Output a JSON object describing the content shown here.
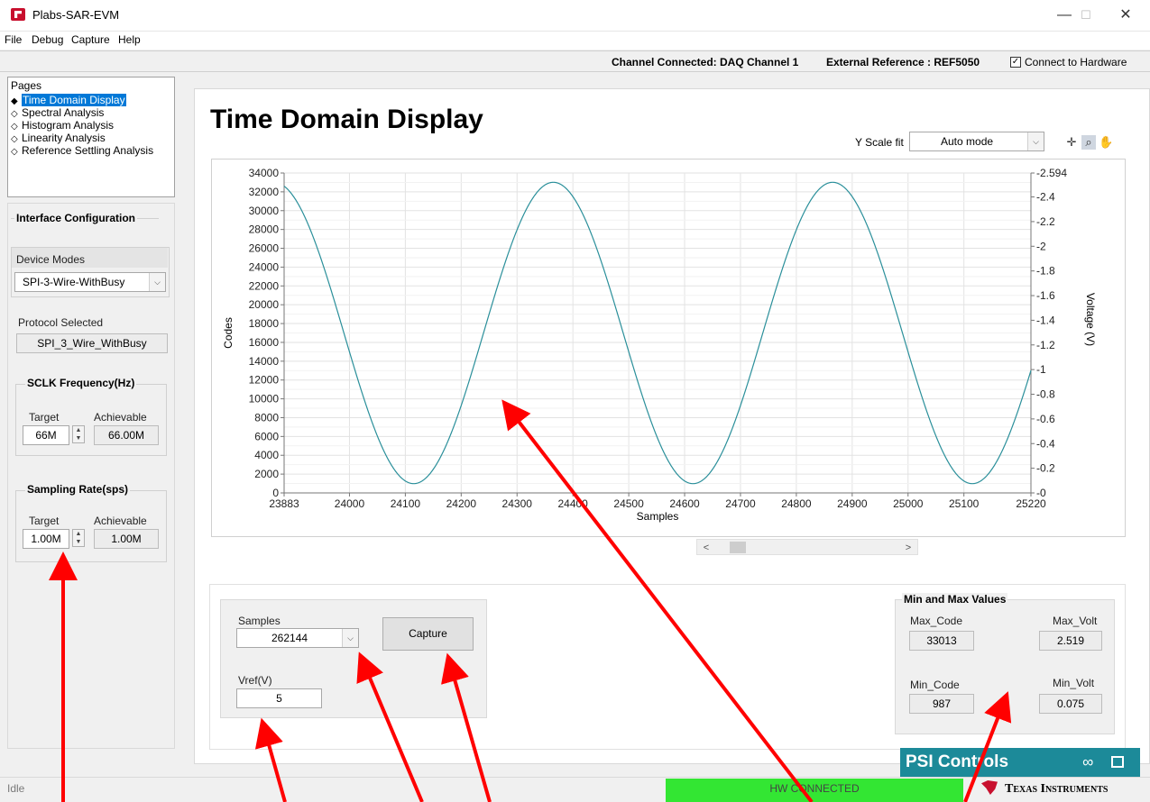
{
  "window": {
    "title": "Plabs-SAR-EVM",
    "minimize": "—",
    "maximize": "☐",
    "close": "✕"
  },
  "menu": [
    "File",
    "Debug",
    "Capture",
    "Help"
  ],
  "status_strip": {
    "channel": "Channel Connected: DAQ Channel 1",
    "reference": "External Reference : REF5050",
    "connect_label": "Connect to Hardware",
    "connect_checked": "✓"
  },
  "pages": {
    "title": "Pages",
    "items": [
      {
        "label": "Time Domain Display",
        "glyph": "◆"
      },
      {
        "label": "Spectral Analysis",
        "glyph": "◇"
      },
      {
        "label": "Histogram Analysis",
        "glyph": "◇"
      },
      {
        "label": "Linearity Analysis",
        "glyph": "◇"
      },
      {
        "label": "Reference Settling Analysis",
        "glyph": "◇"
      }
    ]
  },
  "interface": {
    "title": "Interface Configuration",
    "device_modes_label": "Device Modes",
    "device_mode_value": "SPI-3-Wire-WithBusy",
    "protocol_label": "Protocol Selected",
    "protocol_value": "SPI_3_Wire_WithBusy",
    "sclk": {
      "title": "SCLK Frequency(Hz)",
      "target_label": "Target",
      "achievable_label": "Achievable",
      "target_value": "66M",
      "achievable_value": "66.00M"
    },
    "sampling": {
      "title": "Sampling Rate(sps)",
      "target_label": "Target",
      "achievable_label": "Achievable",
      "target_value": "1.00M",
      "achievable_value": "1.00M"
    }
  },
  "main": {
    "title": "Time Domain Display",
    "yscale_label": "Y Scale fit",
    "yscale_value": "Auto mode",
    "tools": [
      "crosshair-icon",
      "zoom-icon",
      "pan-hand-icon"
    ]
  },
  "chart_data": {
    "type": "line",
    "xlabel": "Samples",
    "ylabel": "Codes",
    "y2label": "Voltage (V)",
    "xlim": [
      23883,
      25220
    ],
    "ylim": [
      0,
      34000
    ],
    "y2lim": [
      0,
      2.594
    ],
    "xticks": [
      "23883",
      "24000",
      "24100",
      "24200",
      "24300",
      "24400",
      "24500",
      "24600",
      "24700",
      "24800",
      "24900",
      "25000",
      "25100",
      "25220"
    ],
    "yticks": [
      "0",
      "2000",
      "4000",
      "6000",
      "8000",
      "10000",
      "12000",
      "14000",
      "16000",
      "18000",
      "20000",
      "22000",
      "24000",
      "26000",
      "28000",
      "30000",
      "32000",
      "34000"
    ],
    "y2ticks": [
      "0",
      "0.2",
      "0.4",
      "0.6",
      "0.8",
      "1",
      "1.2",
      "1.4",
      "1.6",
      "1.8",
      "2",
      "2.2",
      "2.4",
      "2.594"
    ],
    "grid": true,
    "series": [
      {
        "color": "#2a8f9a",
        "waveform": "sine",
        "min": 987,
        "max": 33013,
        "period_samples": 500,
        "first_min_at": 24115
      }
    ]
  },
  "capture": {
    "samples_label": "Samples",
    "samples_value": "262144",
    "capture_button": "Capture",
    "vref_label": "Vref(V)",
    "vref_value": "5"
  },
  "minmax": {
    "title": "Min and Max Values",
    "max_code_label": "Max_Code",
    "max_code_value": "33013",
    "max_volt_label": "Max_Volt",
    "max_volt_value": "2.519",
    "min_code_label": "Min_Code",
    "min_code_value": "987",
    "min_volt_label": "Min_Volt",
    "min_volt_value": "0.075"
  },
  "psi": {
    "title": "PSI Controls",
    "link_icon": "🔗"
  },
  "statusbar": {
    "state": "Idle",
    "hw_status": "HW CONNECTED",
    "brand": "Texas Instruments"
  },
  "colors": {
    "accent": "#0078d7",
    "psi": "#1c8a99",
    "hw_ok": "#33e633",
    "trace": "#2a8f9a",
    "annotation": "#ff0000"
  }
}
